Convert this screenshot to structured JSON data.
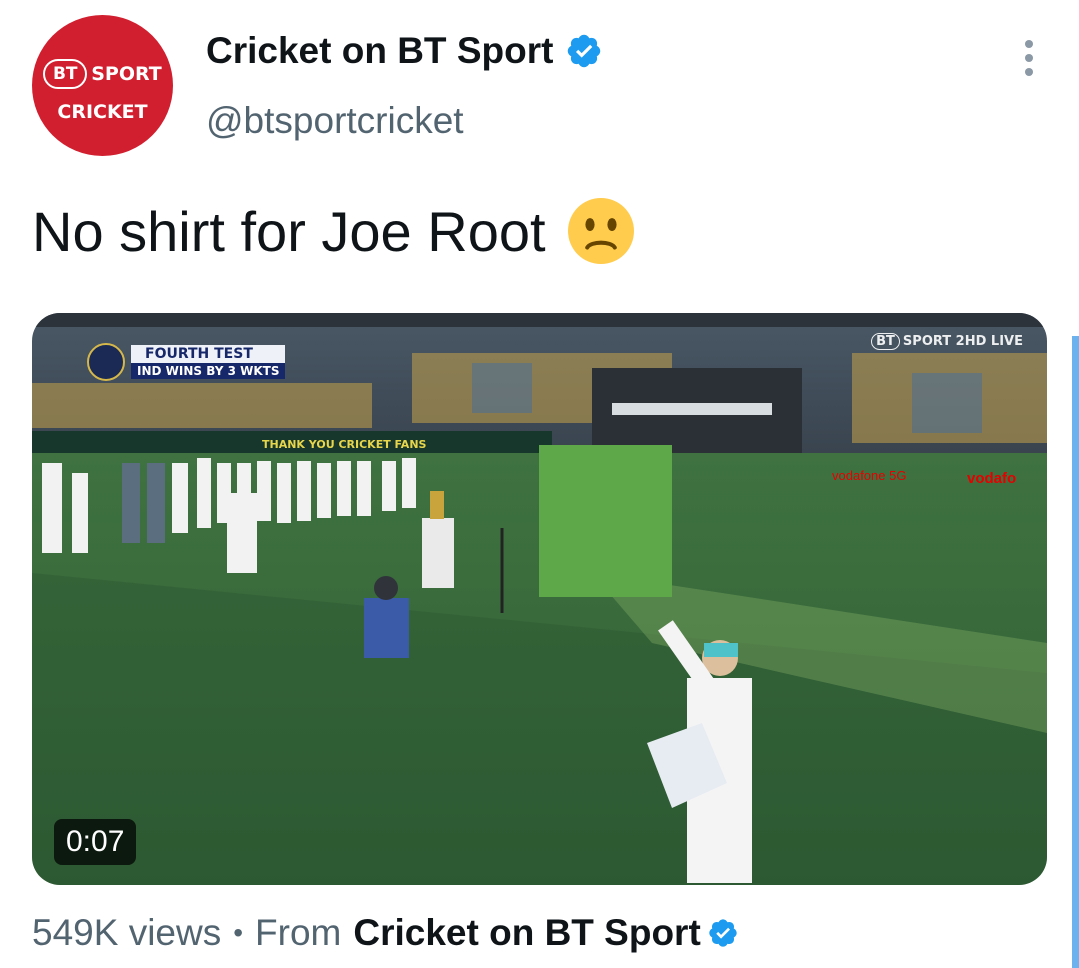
{
  "author": {
    "display_name": "Cricket on BT Sport",
    "handle": "@btsportcricket",
    "avatar_line1_bt": "BT",
    "avatar_line1_word": "SPORT",
    "avatar_line2": "CRICKET",
    "verified": true
  },
  "tweet": {
    "text": "No shirt for Joe Root",
    "emoji": "slightly-frowning-face"
  },
  "media": {
    "duration": "0:07",
    "overlay_title": "FOURTH TEST",
    "overlay_subtitle": "IND WINS BY 3 WKTS",
    "watermark_bt": "BT",
    "watermark_text": "SPORT 2HD LIVE",
    "banner_text": "THANK YOU CRICKET FANS",
    "ad_text_1": "vodafone 5G",
    "ad_text_2": "vodafo"
  },
  "meta": {
    "views": "549K views",
    "separator": "•",
    "from_label": "From",
    "from_name": "Cricket on BT Sport"
  },
  "colors": {
    "brand_red": "#d11f2f",
    "verified_blue": "#1d9bf0",
    "secondary_text": "#536471",
    "pitch_green": "#3d6b3e"
  },
  "icons": {
    "more": "more-vertical-icon",
    "verified": "verified-badge-icon"
  }
}
